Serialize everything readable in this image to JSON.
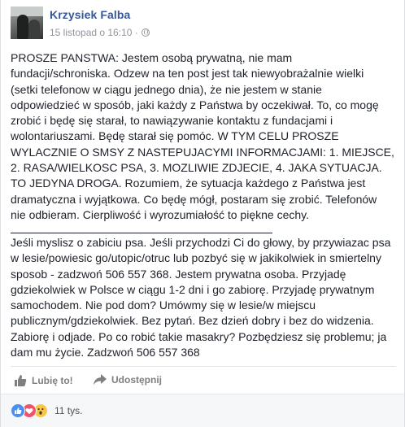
{
  "post": {
    "author": "Krzysiek Falba",
    "date": "15 listopad o 16:10 ·",
    "privacy_icon": "globe-icon",
    "paragraph1_lines": [
      "PROSZE PANSTWA: Jestem osobą prywatną, nie mam",
      "fundacji/schroniska. Odzew na ten post jest tak niewyobrażalnie wielki",
      "(setki telefonow w ciągu jednego dnia), że nie jestem w stanie",
      "odpowiedzieć w sposób, jaki każdy z Państwa by oczekiwał. To, co mogę",
      "zrobić i będę się starał, to nawiązywanie kontaktu z fundacjami i",
      "wolontariuszami. Będę starał się pomóc. W TYM CELU PROSZE",
      "WYLACZNIE O SMSY Z NASTEPUJACYMI INFORMACJAMI: 1. MIEJSCE,",
      "2. RASA/WIELKOSC PSA, 3. MOZLIWIE ZDJECIE, 4. JAKA SYTUACJA.",
      "TO JEDYNA DROGA. Rozumiem, że sytuacja każdego z Państwa jest",
      "dramatyczna i wyjątkowa. Co będę mógł, postaram się zrobić. Telefonów",
      "nie odbieram. Cierpliwość i wyrozumiałość to piękne cechy."
    ],
    "paragraph2_lines": [
      "Jeśli myslisz o zabiciu psa. Jeśli przychodzi Ci do głowy, by przywiazac psa",
      "w lesie/powiesic go/utopic/otruc lub pozbyć się w jakikolwiek in smiertelny",
      "sposob - zadzwoń 506 557 368. Jestem prywatna osoba. Przyjadę",
      "gdziekolwiek w Polsce w ciągu 1-2 dni i go zabiorę. Przyjadę prywatnym",
      "samochodem. Nie pod dom? Umówmy się w lesie/w miejscu",
      "publicznym/gdziekolwiek. Bez pytań. Bez dzień dobry i bez do widzenia.",
      "Zabiorę i odjade. Po co robić takie masakry? Pozbędziesz się problemu; ja",
      "dam mu życie. Zadzwoń 506 557 368"
    ]
  },
  "actions": {
    "like_label": "Lubię to!",
    "like_icon": "thumbs-up-icon",
    "share_label": "Udostępnij",
    "share_icon": "share-arrow-icon"
  },
  "reactions": {
    "icons": [
      "like-reaction-icon",
      "love-reaction-icon",
      "wow-reaction-icon"
    ],
    "count_label": "11 tys."
  },
  "colors": {
    "author": "#365899",
    "meta": "#90949c",
    "action": "#7f7f7f"
  }
}
